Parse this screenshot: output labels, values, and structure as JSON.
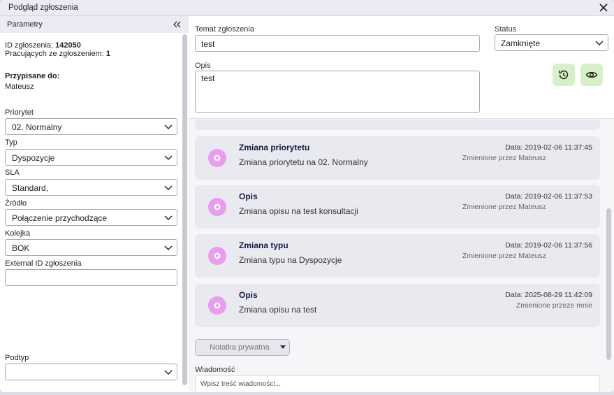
{
  "window": {
    "title": "Podgląd zgłoszenia"
  },
  "left": {
    "header": "Parametry",
    "ticket_id_label": "ID zgłoszenia: ",
    "ticket_id": "142050",
    "working_label": "Pracujących ze zgłoszeniem: ",
    "working_count": "1",
    "assigned_label": "Przypisane do:",
    "assigned_value": "Mateusz",
    "fields": {
      "priority": {
        "label": "Priorytet",
        "value": "02. Normalny"
      },
      "type": {
        "label": "Typ",
        "value": "Dyspozycje"
      },
      "sla": {
        "label": "SLA",
        "value": "Standard,"
      },
      "source": {
        "label": "Źródło",
        "value": "Połączenie przychodzące"
      },
      "queue": {
        "label": "Kolejka",
        "value": "BOK"
      },
      "external_id": {
        "label": "External ID zgłoszenia",
        "value": ""
      },
      "subtype": {
        "label": "Podtyp",
        "value": ""
      }
    }
  },
  "right": {
    "subject_label": "Temat zgłoszenia",
    "subject_value": "test",
    "status_label": "Status",
    "status_value": "Zamknięte",
    "description_label": "Opis",
    "description_value": "test",
    "history_icon": "history-icon",
    "preview_icon": "eye-icon",
    "cards": [
      {
        "title": "Zmiana priorytetu",
        "desc": "Zmiana priorytetu na 02. Normalny",
        "date": "Data: 2019-02-06 11:37:45",
        "by": "Zmienione przez Mateusz"
      },
      {
        "title": "Opis",
        "desc": "Zmiana opisu na test konsultacji",
        "date": "Data: 2019-02-06 11:37:53",
        "by": "Zmienione przez Mateusz"
      },
      {
        "title": "Zmiana typu",
        "desc": "Zmiana typu na Dyspozycje",
        "date": "Data: 2019-02-06 11:37:56",
        "by": "Zmienione przez Mateusz"
      },
      {
        "title": "Opis",
        "desc": "Zmiana opisu na test",
        "date": "Data: 2025-08-29 11:42:09",
        "by": "Zmienione przeze mnie"
      }
    ],
    "note_button": "Notatka prywatna",
    "message_label": "Wiadomość",
    "message_placeholder": "Wpisz treść wiadomości..."
  },
  "colors": {
    "accent_green": "#d6f0c8",
    "avatar_pink": "#e99cf0",
    "card_bg": "#e9e9f0"
  }
}
